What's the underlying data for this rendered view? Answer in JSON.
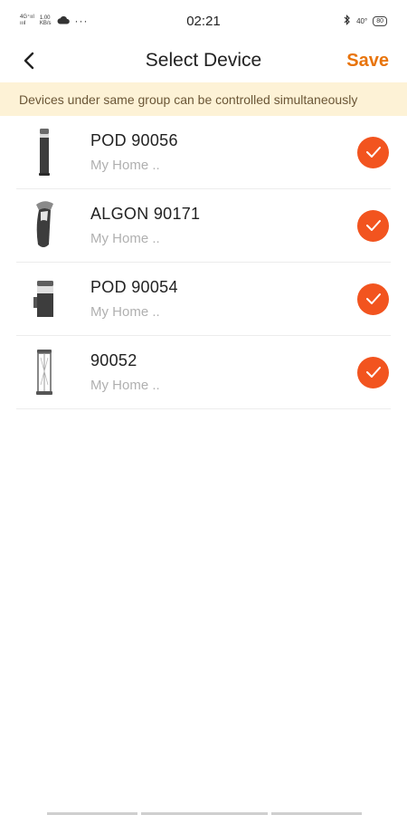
{
  "status_bar": {
    "signal_top": "4G⁺ııl",
    "signal_bottom": "ıııl",
    "speed_value": "1.00",
    "speed_unit": "KB/s",
    "dots": "···",
    "time": "02:21",
    "temperature": "40°",
    "battery": "80"
  },
  "header": {
    "title": "Select Device",
    "save_label": "Save"
  },
  "banner": {
    "text": "Devices under same group can be controlled simultaneously"
  },
  "devices": [
    {
      "name": "POD 90056",
      "location": "My Home ..",
      "selected": true,
      "icon": "bollard-lamp-icon"
    },
    {
      "name": "ALGON 90171",
      "location": "My Home ..",
      "selected": true,
      "icon": "wall-lamp-icon"
    },
    {
      "name": "POD 90054",
      "location": "My Home ..",
      "selected": true,
      "icon": "short-bollard-icon"
    },
    {
      "name": "90052",
      "location": "My Home ..",
      "selected": true,
      "icon": "lantern-post-icon"
    }
  ],
  "colors": {
    "accent": "#e8740c",
    "check": "#f2541f",
    "banner_bg": "#fdf2d6"
  }
}
